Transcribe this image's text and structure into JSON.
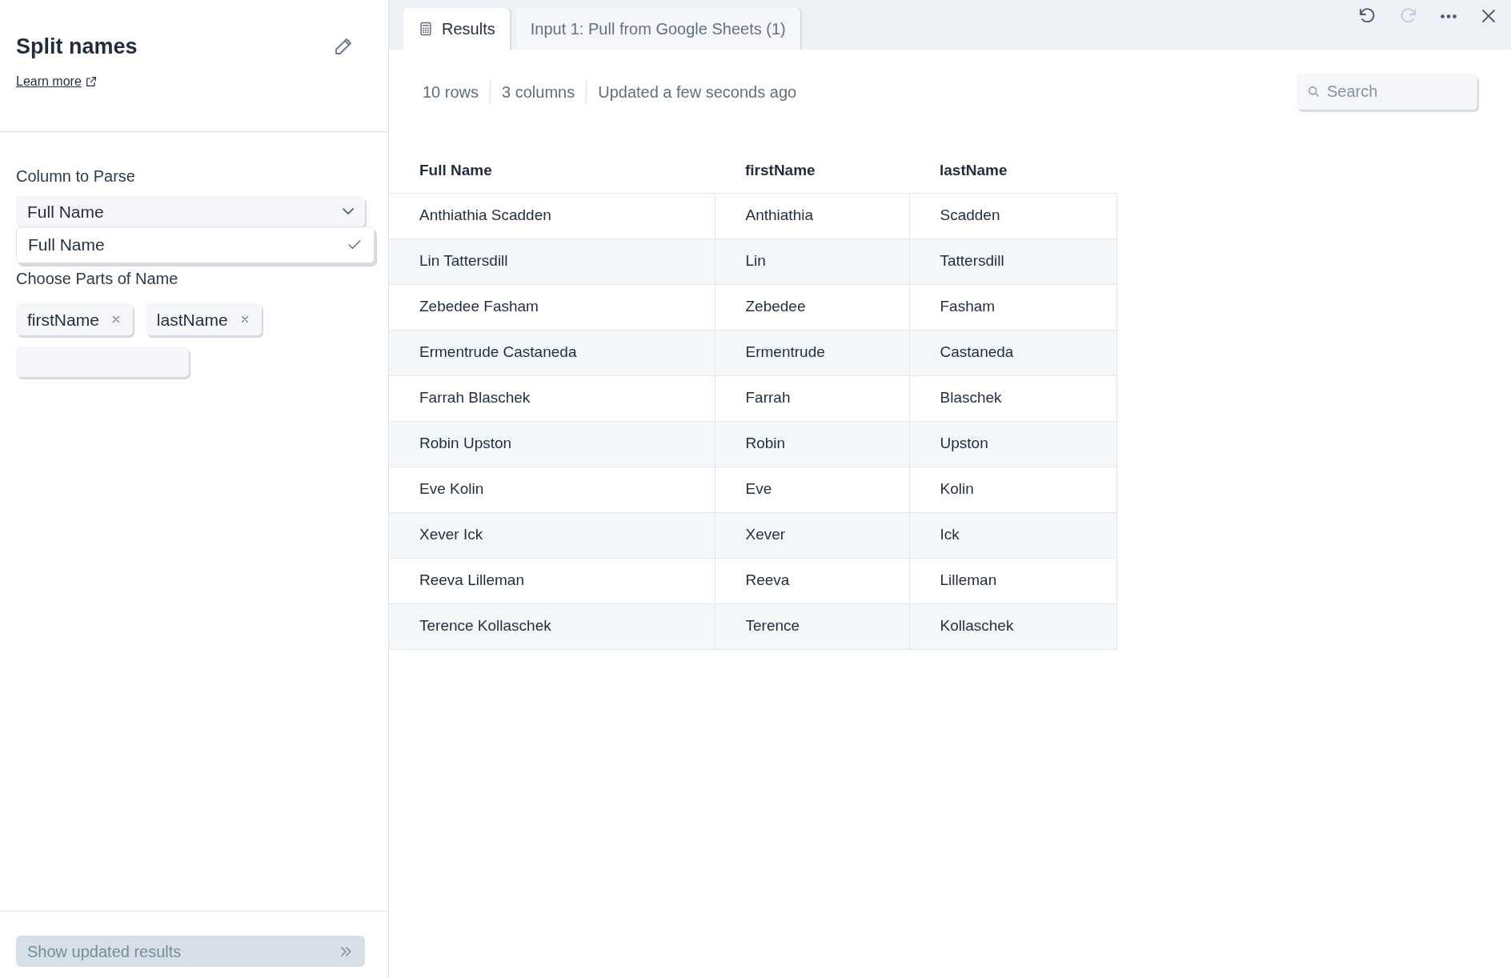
{
  "sidebar": {
    "title": "Split names",
    "learn_more": "Learn more",
    "column_field": {
      "label": "Column to Parse",
      "value": "Full Name"
    },
    "dropdown_menu": [
      {
        "label": "Full Name",
        "selected": true
      }
    ],
    "parts_field": {
      "label": "Choose Parts of Name",
      "tags": [
        "firstName",
        "lastName"
      ]
    },
    "submit_button": {
      "label": "Show updated results",
      "disabled": true
    }
  },
  "tabs": [
    {
      "label": "Results",
      "selected": true,
      "kind": "results"
    },
    {
      "label": "Input 1: Pull from Google Sheets (1)",
      "selected": false,
      "kind": "input"
    }
  ],
  "toolbar": {
    "redo_disabled": true
  },
  "stats": [
    "10 rows",
    "3 columns",
    "Updated a few seconds ago"
  ],
  "search": {
    "placeholder": "Search"
  },
  "table": {
    "columns": [
      "Full Name",
      "firstName",
      "lastName"
    ],
    "rows": [
      [
        "Anthiathia Scadden",
        "Anthiathia",
        "Scadden"
      ],
      [
        "Lin Tattersdill",
        "Lin",
        "Tattersdill"
      ],
      [
        "Zebedee Fasham",
        "Zebedee",
        "Fasham"
      ],
      [
        "Ermentrude Castaneda",
        "Ermentrude",
        "Castaneda"
      ],
      [
        "Farrah Blaschek",
        "Farrah",
        "Blaschek"
      ],
      [
        "Robin Upston",
        "Robin",
        "Upston"
      ],
      [
        "Eve Kolin",
        "Eve",
        "Kolin"
      ],
      [
        "Xever Ick",
        "Xever",
        "Ick"
      ],
      [
        "Reeva Lilleman",
        "Reeva",
        "Lilleman"
      ],
      [
        "Terence Kollaschek",
        "Terence",
        "Kollaschek"
      ]
    ]
  }
}
